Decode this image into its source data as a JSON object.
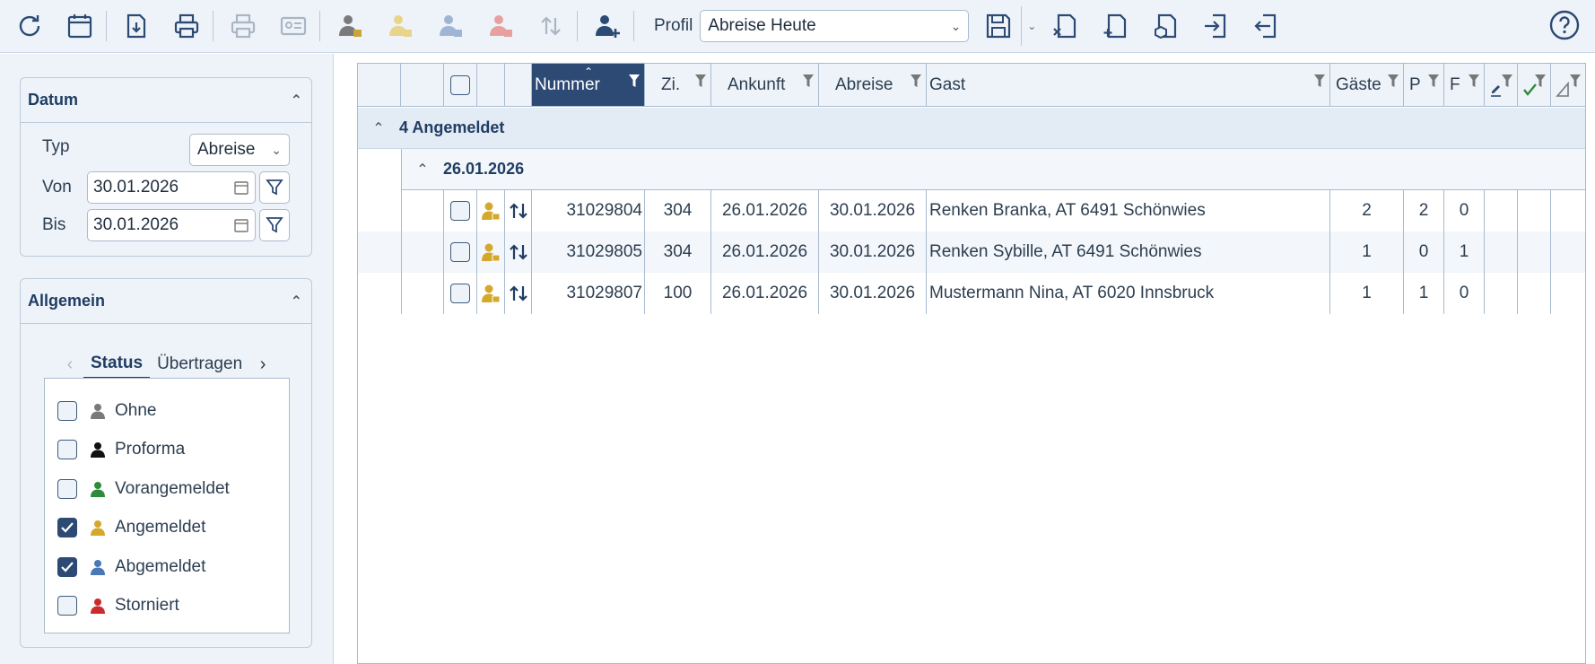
{
  "toolbar": {
    "buttons": [
      {
        "name": "refresh-icon"
      },
      {
        "name": "calendar-icon"
      },
      {
        "name": "download-icon"
      },
      {
        "name": "print-icon"
      },
      {
        "name": "print-disabled-icon"
      },
      {
        "name": "id-card-icon"
      },
      {
        "name": "person-gray-icon"
      },
      {
        "name": "person-yellow-icon"
      },
      {
        "name": "person-blue-icon"
      },
      {
        "name": "person-red-icon"
      },
      {
        "name": "swap-arrows-icon"
      },
      {
        "name": "add-person-icon"
      }
    ],
    "profil_label": "Profil",
    "profil_value": "Abreise Heute",
    "actions": [
      {
        "name": "save-icon"
      },
      {
        "name": "export-excel-icon"
      },
      {
        "name": "add-document-icon"
      },
      {
        "name": "document-box-icon"
      },
      {
        "name": "import-icon"
      },
      {
        "name": "export-icon"
      }
    ],
    "help_icon": "help-icon"
  },
  "sidebar": {
    "datum": {
      "title": "Datum",
      "typ_label": "Typ",
      "typ_value": "Abreise",
      "von_label": "Von",
      "von_value": "30.01.2026",
      "bis_label": "Bis",
      "bis_value": "30.01.2026"
    },
    "allgemein": {
      "title": "Allgemein",
      "tabs": [
        "Status",
        "Übertragen"
      ],
      "status_items": [
        {
          "label": "Ohne",
          "checked": false,
          "color": "#7a7a7a"
        },
        {
          "label": "Proforma",
          "checked": false,
          "color": "#111111"
        },
        {
          "label": "Vorangemeldet",
          "checked": false,
          "color": "#2e8b3a"
        },
        {
          "label": "Angemeldet",
          "checked": true,
          "color": "#d4a82a"
        },
        {
          "label": "Abgemeldet",
          "checked": true,
          "color": "#4a78b5"
        },
        {
          "label": "Storniert",
          "checked": false,
          "color": "#cc2b2b"
        }
      ]
    }
  },
  "grid": {
    "headers": {
      "nummer": "Nummer",
      "zi": "Zi.",
      "ankunft": "Ankunft",
      "abreise": "Abreise",
      "gast": "Gast",
      "gaeste": "Gäste",
      "p": "P",
      "f": "F"
    },
    "group1": "4 Angemeldet",
    "group2": "26.01.2026",
    "rows": [
      {
        "nummer": "31029804",
        "zi": "304",
        "ankunft": "26.01.2026",
        "abreise": "30.01.2026",
        "gast": "Renken Branka, AT 6491 Schönwies",
        "gaeste": "2",
        "p": "2",
        "f": "0"
      },
      {
        "nummer": "31029805",
        "zi": "304",
        "ankunft": "26.01.2026",
        "abreise": "30.01.2026",
        "gast": "Renken Sybille, AT 6491 Schönwies",
        "gaeste": "1",
        "p": "0",
        "f": "1"
      },
      {
        "nummer": "31029807",
        "zi": "100",
        "ankunft": "26.01.2026",
        "abreise": "30.01.2026",
        "gast": "Mustermann Nina, AT 6020 Innsbruck",
        "gaeste": "1",
        "p": "1",
        "f": "0"
      }
    ],
    "colors": {
      "accent": "#2c4a73",
      "status_angemeldet": "#d4a82a"
    }
  }
}
